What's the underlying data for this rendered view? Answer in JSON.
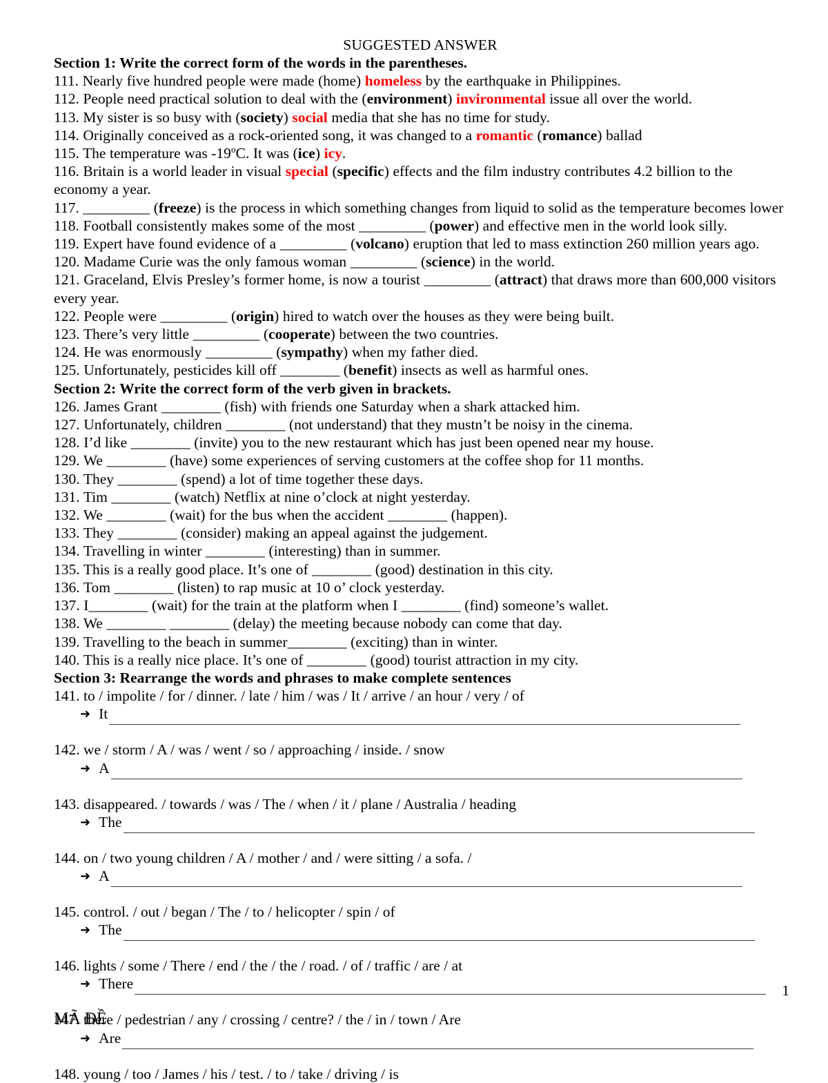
{
  "document": {
    "title": "SUGGESTED ANSWER",
    "page_number": "1",
    "footer_code": "MÃ ĐỀ"
  },
  "section1": {
    "heading": "Section 1: Write the correct form of the words in the parentheses.",
    "items": [
      {
        "number": "111.",
        "parts": [
          {
            "t": "Nearly five hundred people were made (home) ",
            "s": "plain"
          },
          {
            "t": "homeless",
            "s": "answer"
          },
          {
            "t": " by the earthquake in Philippines.",
            "s": "plain"
          }
        ]
      },
      {
        "number": "112.",
        "parts": [
          {
            "t": "People need practical solution to deal with the (",
            "s": "plain"
          },
          {
            "t": "environment",
            "s": "bold"
          },
          {
            "t": ") ",
            "s": "plain"
          },
          {
            "t": "invironmental",
            "s": "answer"
          },
          {
            "t": " issue all over the world.",
            "s": "plain"
          }
        ]
      },
      {
        "number": "113.",
        "parts": [
          {
            "t": "My sister is so busy with (",
            "s": "plain"
          },
          {
            "t": "society",
            "s": "bold"
          },
          {
            "t": ") ",
            "s": "plain"
          },
          {
            "t": "social",
            "s": "answer"
          },
          {
            "t": " media that she has no time for study.",
            "s": "plain"
          }
        ]
      },
      {
        "number": "114.",
        "parts": [
          {
            "t": "Originally conceived as a rock-oriented song, it was changed to a ",
            "s": "plain"
          },
          {
            "t": "romantic",
            "s": "answer"
          },
          {
            "t": " (",
            "s": "plain"
          },
          {
            "t": "romance",
            "s": "bold"
          },
          {
            "t": ") ballad",
            "s": "plain"
          }
        ]
      },
      {
        "number": "115.",
        "parts": [
          {
            "t": "The temperature was -19",
            "s": "plain"
          },
          {
            "t": "o",
            "s": "degree"
          },
          {
            "t": "C. It was (",
            "s": "plain"
          },
          {
            "t": "ice",
            "s": "bold"
          },
          {
            "t": ") ",
            "s": "plain"
          },
          {
            "t": "icy",
            "s": "answer"
          },
          {
            "t": ".",
            "s": "plain"
          }
        ]
      },
      {
        "number": "116.",
        "parts": [
          {
            "t": "Britain is a world leader in visual ",
            "s": "plain"
          },
          {
            "t": "special",
            "s": "answer"
          },
          {
            "t": " (",
            "s": "plain"
          },
          {
            "t": "specific",
            "s": "bold"
          },
          {
            "t": ") effects and the film industry contributes 4.2 billion to the economy a year.",
            "s": "plain"
          }
        ]
      },
      {
        "number": "117.",
        "parts": [
          {
            "t": " _________ (",
            "s": "plain"
          },
          {
            "t": "freeze",
            "s": "bold"
          },
          {
            "t": ") is the process in which something changes from liquid to solid as the temperature becomes lower",
            "s": "plain"
          }
        ]
      },
      {
        "number": "118.",
        "parts": [
          {
            "t": "Football consistently makes some of the most _________ (",
            "s": "plain"
          },
          {
            "t": "power",
            "s": "bold"
          },
          {
            "t": ") and effective men in the world look silly.",
            "s": "plain"
          }
        ]
      },
      {
        "number": "119.",
        "parts": [
          {
            "t": "Expert have found evidence of a _________ (",
            "s": "plain"
          },
          {
            "t": "volcano",
            "s": "bold"
          },
          {
            "t": ") eruption that led to mass extinction 260 million years ago.",
            "s": "plain"
          }
        ]
      },
      {
        "number": "120.",
        "parts": [
          {
            "t": "Madame Curie was the only famous woman _________ (",
            "s": "plain"
          },
          {
            "t": "science",
            "s": "bold"
          },
          {
            "t": ") in the world.",
            "s": "plain"
          }
        ]
      },
      {
        "number": "121.",
        "parts": [
          {
            "t": "Graceland, Elvis Presley’s former home, is now a tourist _________ (",
            "s": "plain"
          },
          {
            "t": "attract",
            "s": "bold"
          },
          {
            "t": ") that draws more than 600,000 visitors every year.",
            "s": "plain"
          }
        ]
      },
      {
        "number": "122.",
        "parts": [
          {
            "t": "People were _________ (",
            "s": "plain"
          },
          {
            "t": "origin",
            "s": "bold"
          },
          {
            "t": ") hired to watch over the houses as they were being built.",
            "s": "plain"
          }
        ]
      },
      {
        "number": "123.",
        "parts": [
          {
            "t": "There’s very little _________ (",
            "s": "plain"
          },
          {
            "t": "cooperate",
            "s": "bold"
          },
          {
            "t": ") between the two countries.",
            "s": "plain"
          }
        ]
      },
      {
        "number": "124.",
        "parts": [
          {
            "t": "He was enormously _________ (",
            "s": "plain"
          },
          {
            "t": "sympathy",
            "s": "bold"
          },
          {
            "t": ") when my father died.",
            "s": "plain"
          }
        ]
      },
      {
        "number": "125.",
        "parts": [
          {
            "t": "Unfortunately, pesticides kill off ________ (",
            "s": "plain"
          },
          {
            "t": "benefit",
            "s": "bold"
          },
          {
            "t": ") insects as well as harmful ones.",
            "s": "plain"
          }
        ]
      }
    ]
  },
  "section2": {
    "heading": "Section 2: Write the correct form of the verb given in brackets.",
    "items": [
      {
        "number": "126.",
        "text": "James Grant ________ (fish) with friends one Saturday when a shark attacked him."
      },
      {
        "number": "127.",
        "text": "Unfortunately, children ________ (not understand) that they mustn’t be noisy in the cinema."
      },
      {
        "number": "128.",
        "text": "I’d like ________ (invite) you to the new restaurant which has just been opened near my house."
      },
      {
        "number": "129.",
        "text": "We ________ (have) some experiences of serving customers at the coffee shop for 11 months."
      },
      {
        "number": "130.",
        "text": "They ________ (spend) a lot of time together these days."
      },
      {
        "number": "131.",
        "text": "Tim ________ (watch) Netflix at nine o’clock at night yesterday."
      },
      {
        "number": "132.",
        "text": "We ________ (wait) for the bus when the accident ________ (happen)."
      },
      {
        "number": "133.",
        "text": "They ________ (consider) making an appeal against the judgement."
      },
      {
        "number": "134.",
        "text": "Travelling in winter ________ (interesting) than in summer."
      },
      {
        "number": "135.",
        "text": "This is a really good place. It’s one of ________ (good) destination in this city."
      },
      {
        "number": "136.",
        "text": "Tom ________ (listen) to rap music at 10 o’ clock yesterday."
      },
      {
        "number": "137.",
        "text": "I________ (wait) for the train at the platform when I ________ (find) someone’s wallet."
      },
      {
        "number": "138.",
        "text": "We ________ ________ (delay) the meeting because nobody can come that day."
      },
      {
        "number": "139.",
        "text": "Travelling to the beach in summer________ (exciting) than in winter."
      },
      {
        "number": "140.",
        "text": "This is a really nice place. It’s one of ________ (good) tourist attraction in my city."
      }
    ]
  },
  "section3": {
    "heading": "Section 3: Rearrange the words and phrases to make complete sentences",
    "arrow_glyph": "➜",
    "items": [
      {
        "number": "141.",
        "prompt": "to / impolite / for / dinner. / late / him / was / It / arrive / an hour / very / of",
        "lead": "It"
      },
      {
        "number": "142.",
        "prompt": "we / storm / A / was / went / so / approaching / inside. / snow",
        "lead": "A"
      },
      {
        "number": "143.",
        "prompt": "disappeared. / towards / was / The / when / it / plane / Australia / heading",
        "lead": "The"
      },
      {
        "number": "144.",
        "prompt": "on / two young children / A / mother / and / were sitting / a sofa. /",
        "lead": "A"
      },
      {
        "number": "145.",
        "prompt": "control. / out / began / The / to / helicopter / spin / of",
        "lead": "The"
      },
      {
        "number": "146.",
        "prompt": "lights / some / There / end / the / the / road. / of / traffic / are / at",
        "lead": "There"
      },
      {
        "number": "147.",
        "prompt": "there / pedestrian / any / crossing / centre? / the / in / town / Are",
        "lead": "Are"
      },
      {
        "number": "148.",
        "prompt": "young / too / James / his / test. / to / take / driving / is",
        "lead": ""
      }
    ]
  },
  "colors": {
    "answer_red": "#ff0000",
    "text_black": "#000000",
    "rule_gray": "#3a3a3a"
  }
}
